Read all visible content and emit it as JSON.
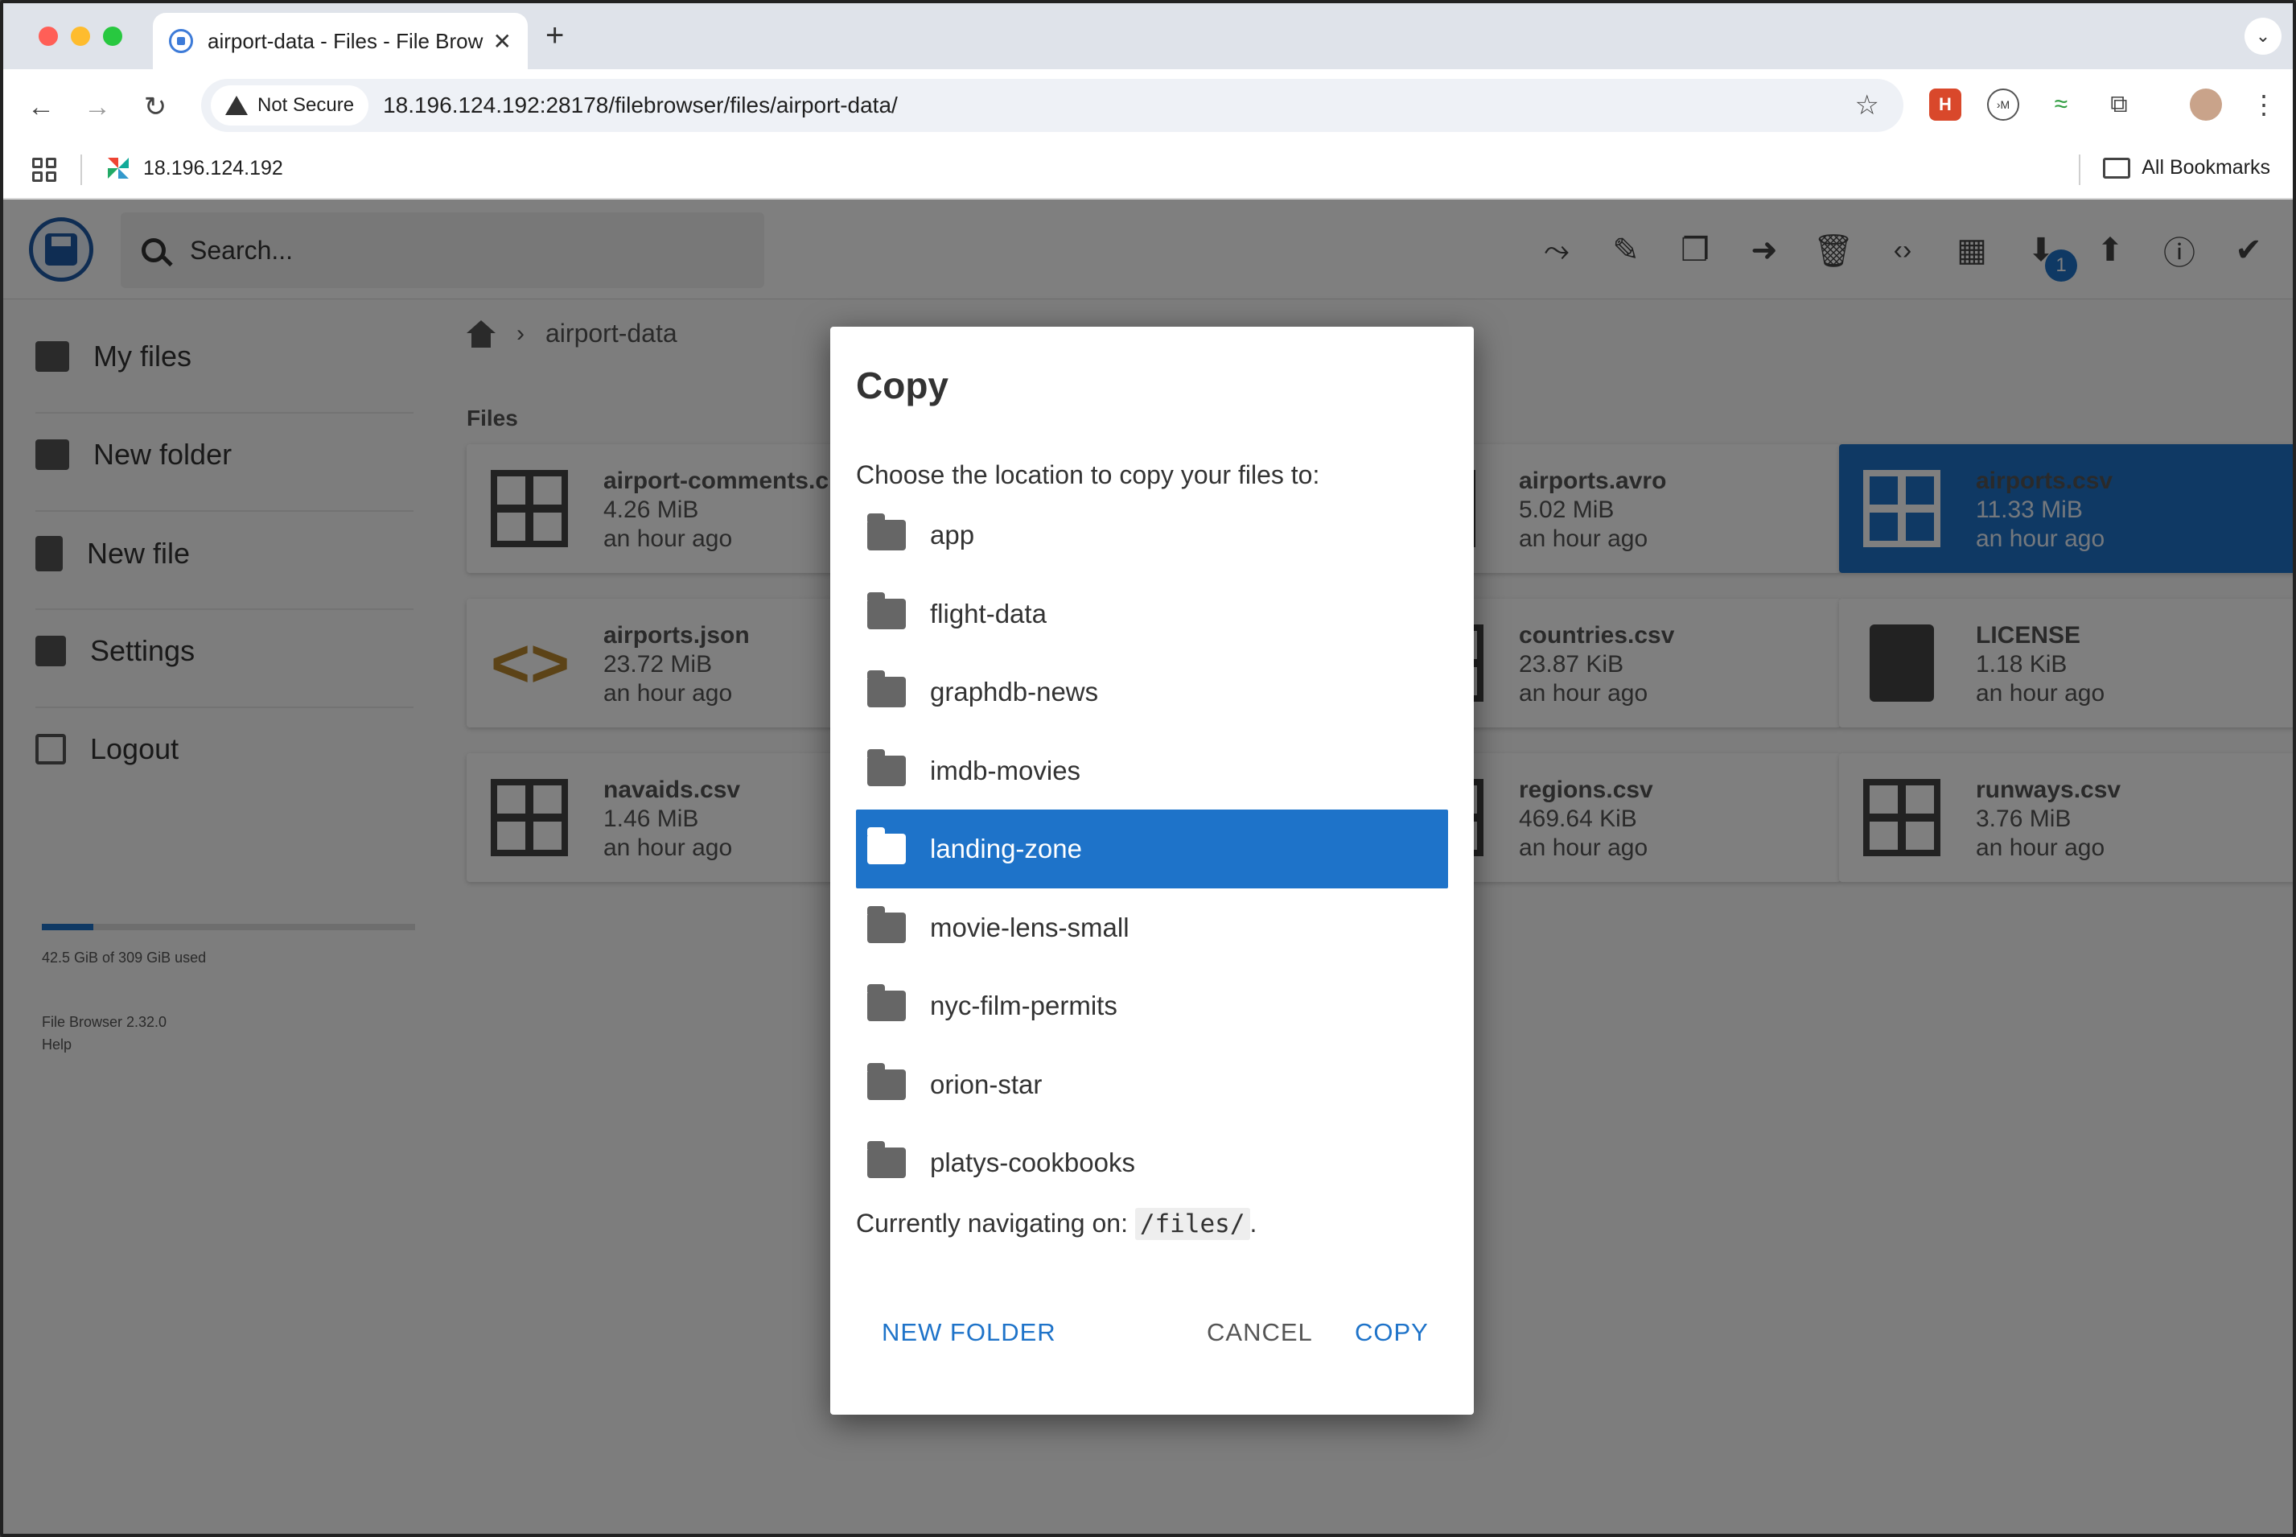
{
  "browser": {
    "tab_title": "airport-data - Files - File Brow",
    "security_label": "Not Secure",
    "url": "18.196.124.192:28178/filebrowser/files/airport-data/",
    "bookmark_site": "18.196.124.192",
    "all_bookmarks": "All Bookmarks"
  },
  "header": {
    "search_placeholder": "Search...",
    "download_badge": "1"
  },
  "sidebar": {
    "items": [
      {
        "label": "My files"
      },
      {
        "label": "New folder"
      },
      {
        "label": "New file"
      },
      {
        "label": "Settings"
      },
      {
        "label": "Logout"
      }
    ],
    "usage_text": "42.5 GiB of 309 GiB used",
    "usage_fraction": 0.1375,
    "version": "File Browser 2.32.0",
    "help": "Help"
  },
  "main": {
    "breadcrumb": "airport-data",
    "section_title": "Files",
    "files": [
      {
        "name": "airport-comments.c",
        "size": "4.26 MiB",
        "modified": "an hour ago",
        "icon": "grid-icon"
      },
      {
        "name": "airports.avro",
        "size": "5.02 MiB",
        "modified": "an hour ago",
        "icon": "file-icon"
      },
      {
        "name": "airports.csv",
        "size": "11.33 MiB",
        "modified": "an hour ago",
        "icon": "grid-icon",
        "selected": true
      },
      {
        "name": "airports.json",
        "size": "23.72 MiB",
        "modified": "an hour ago",
        "icon": "code-icon"
      },
      {
        "name": "countries.csv",
        "size": "23.87 KiB",
        "modified": "an hour ago",
        "icon": "grid-icon"
      },
      {
        "name": "LICENSE",
        "size": "1.18 KiB",
        "modified": "an hour ago",
        "icon": "document-icon"
      },
      {
        "name": "navaids.csv",
        "size": "1.46 MiB",
        "modified": "an hour ago",
        "icon": "grid-icon"
      },
      {
        "name": "regions.csv",
        "size": "469.64 KiB",
        "modified": "an hour ago",
        "icon": "grid-icon"
      },
      {
        "name": "runways.csv",
        "size": "3.76 MiB",
        "modified": "an hour ago",
        "icon": "grid-icon"
      }
    ]
  },
  "dialog": {
    "title": "Copy",
    "prompt": "Choose the location to copy your files to:",
    "folders": [
      "app",
      "flight-data",
      "graphdb-news",
      "imdb-movies",
      "landing-zone",
      "movie-lens-small",
      "nyc-film-permits",
      "orion-star",
      "platys-cookbooks"
    ],
    "selected_folder": "landing-zone",
    "nav_prefix": "Currently navigating on: ",
    "nav_path": "/files/",
    "nav_suffix": ".",
    "new_folder_button": "NEW FOLDER",
    "cancel_button": "CANCEL",
    "copy_button": "COPY"
  },
  "colors": {
    "accent": "#1e73c9",
    "overlay": "rgba(0,0,0,0.5)"
  }
}
